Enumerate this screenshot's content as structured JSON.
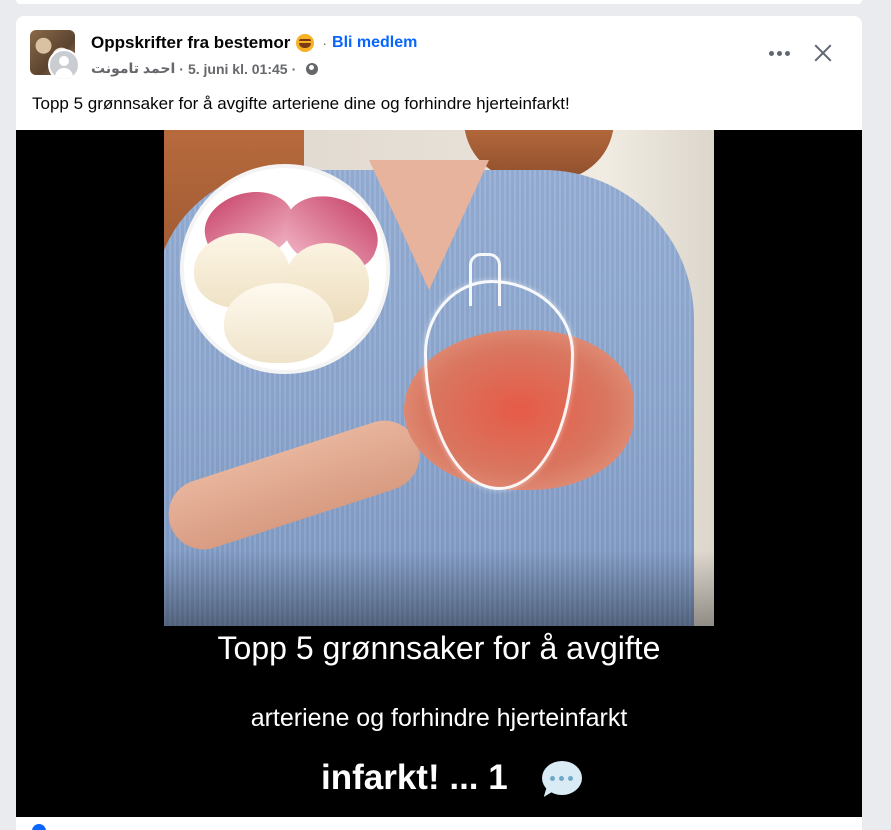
{
  "post": {
    "group_name": "Oppskrifter fra bestemor",
    "join_label": "Bli medlem",
    "author": "احمد تامونت",
    "separator": "·",
    "timestamp": "5. juni kl. 01:45",
    "text": "Topp 5 grønnsaker for å avgifte arteriene dine og forhindre hjerteinfarkt!",
    "icons": [
      "group-avatar",
      "user-avatar",
      "smiling-emoji-icon",
      "globe-icon",
      "more-icon",
      "close-icon",
      "chat-bubble-icon"
    ]
  },
  "media": {
    "caption_line1": "Topp 5 grønnsaker for å avgifte",
    "caption_line2": "arteriene og forhindre hjerteinfarkt",
    "caption_line3": "infarkt! ... 1"
  },
  "colors": {
    "link": "#0866ff",
    "meta": "#65676b",
    "text": "#050505",
    "page_bg": "#e9ebee",
    "media_bg": "#000000"
  }
}
